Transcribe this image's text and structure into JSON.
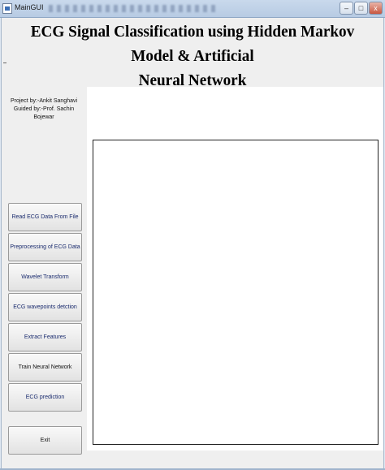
{
  "window": {
    "title": "MainGUI",
    "controls": {
      "minimize": "–",
      "maximize": "□",
      "close": "x"
    }
  },
  "heading": {
    "line1": "ECG Signal Classification using Hidden Markov Model & Artificial",
    "line2": "Neural Network"
  },
  "credits": {
    "project_by": "Project by:-Ankit Sanghavi",
    "guided_by": "Guided by:-Prof. Sachin Bojewar"
  },
  "buttons": [
    {
      "label": "Read ECG Data From File"
    },
    {
      "label": "Preprocessing of ECG Data"
    },
    {
      "label": "Wavelet Transform"
    },
    {
      "label": "ECG wavepoints detction"
    },
    {
      "label": "Extract Features"
    },
    {
      "label": "Train Neural Network"
    },
    {
      "label": "ECG prediction"
    },
    {
      "label": "Exit"
    }
  ]
}
